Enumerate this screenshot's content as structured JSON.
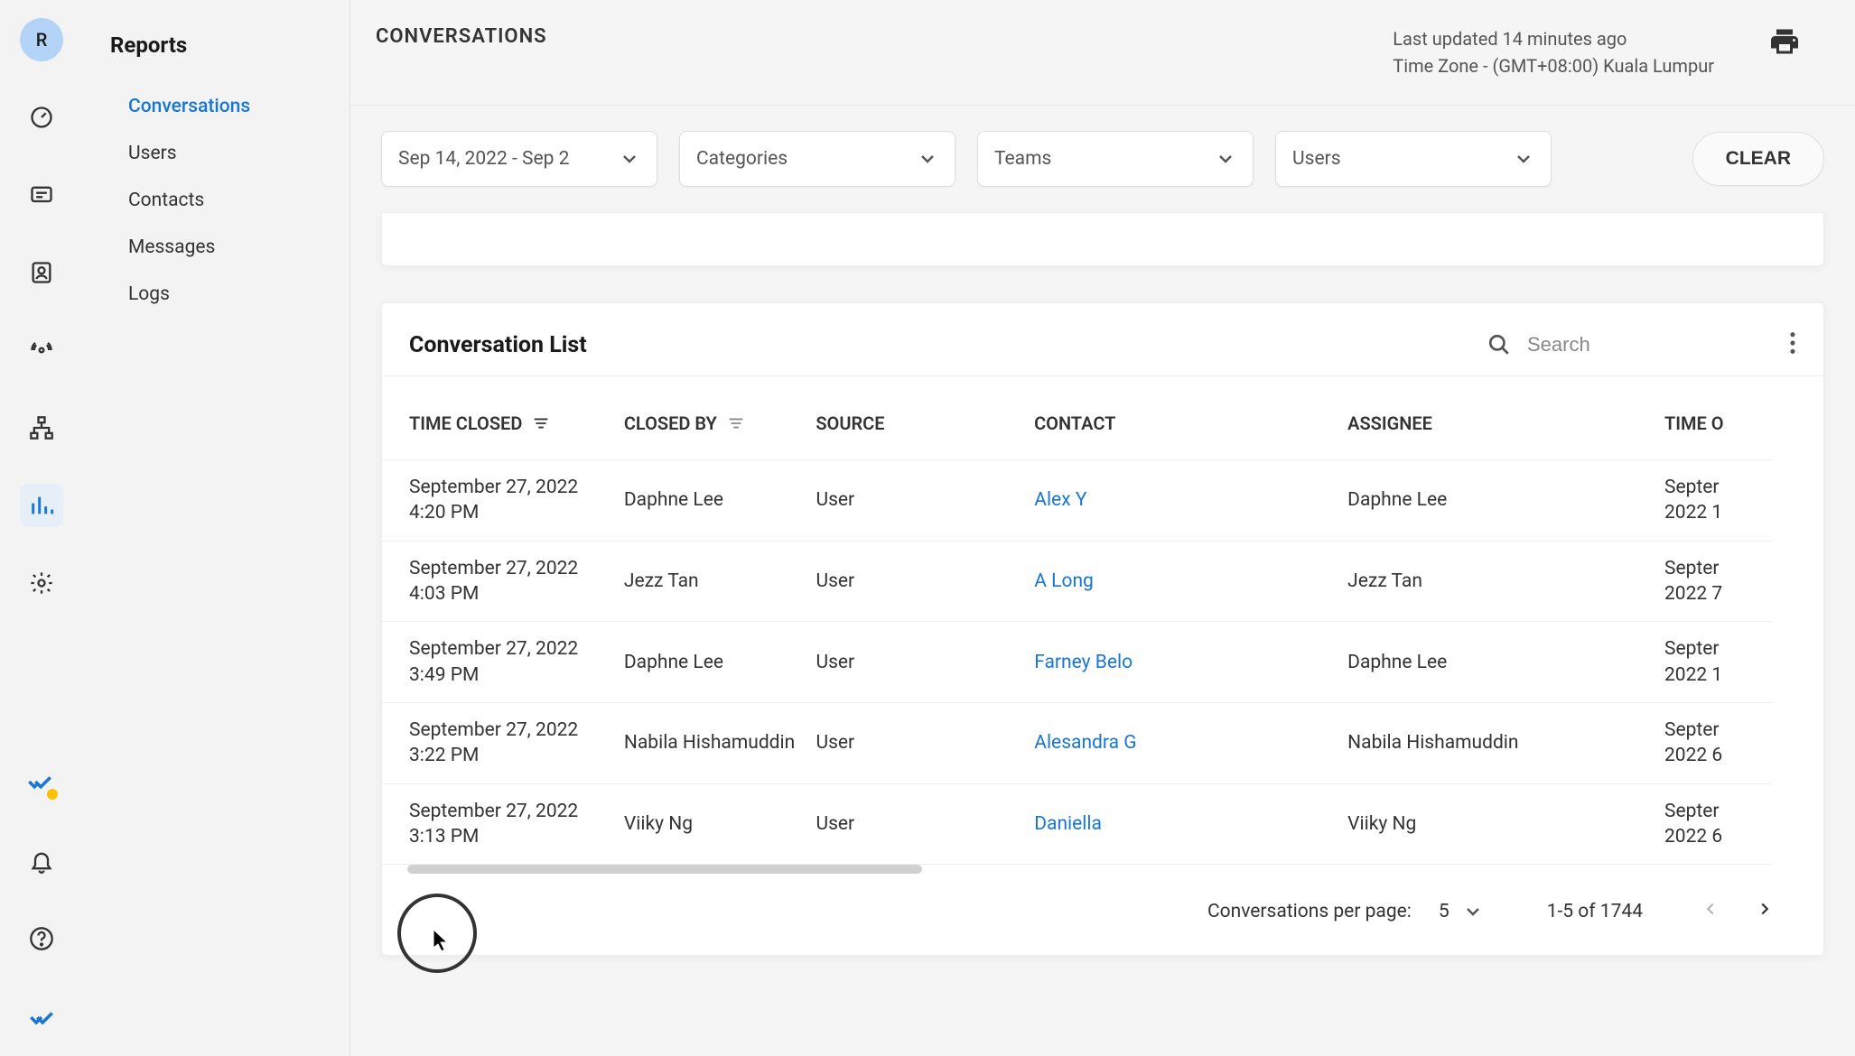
{
  "avatar_initial": "R",
  "sidebar": {
    "title": "Reports",
    "items": [
      "Conversations",
      "Users",
      "Contacts",
      "Messages",
      "Logs"
    ],
    "active": 0
  },
  "header": {
    "title": "CONVERSATIONS",
    "last_updated": "Last updated 14 minutes ago",
    "timezone": "Time Zone - (GMT+08:00) Kuala Lumpur"
  },
  "filters": {
    "date_range": "Sep 14, 2022 - Sep 2",
    "categories": "Categories",
    "teams": "Teams",
    "users": "Users",
    "clear": "CLEAR"
  },
  "list": {
    "title": "Conversation List",
    "search_placeholder": "Search",
    "columns": [
      "TIME CLOSED",
      "CLOSED BY",
      "SOURCE",
      "CONTACT",
      "ASSIGNEE",
      "TIME O"
    ],
    "rows": [
      {
        "time_closed": "September 27, 2022 4:20 PM",
        "closed_by": "Daphne Lee",
        "source": "User",
        "contact": "Alex Y",
        "assignee": "Daphne Lee",
        "time2": "Septer 2022 1"
      },
      {
        "time_closed": "September 27, 2022 4:03 PM",
        "closed_by": "Jezz Tan",
        "source": "User",
        "contact": "A Long",
        "assignee": "Jezz Tan",
        "time2": "Septer 2022 7"
      },
      {
        "time_closed": "September 27, 2022 3:49 PM",
        "closed_by": "Daphne Lee",
        "source": "User",
        "contact": "Farney Belo",
        "assignee": "Daphne Lee",
        "time2": "Septer 2022 1"
      },
      {
        "time_closed": "September 27, 2022 3:22 PM",
        "closed_by": "Nabila Hishamuddin",
        "source": "User",
        "contact": "Alesandra G",
        "assignee": "Nabila Hishamuddin",
        "time2": "Septer 2022 6"
      },
      {
        "time_closed": "September 27, 2022 3:13 PM",
        "closed_by": "Viiky Ng",
        "source": "User",
        "contact": "Daniella",
        "assignee": "Viiky Ng",
        "time2": "Septer 2022 6"
      }
    ]
  },
  "pager": {
    "label": "Conversations per page:",
    "size": "5",
    "range": "1-5 of 1744"
  }
}
